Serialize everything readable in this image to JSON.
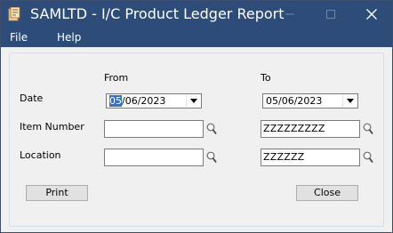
{
  "window": {
    "title": "SAMLTD - I/C Product Ledger Report",
    "min_label": "—",
    "max_label": "□",
    "close_label": "✕"
  },
  "menu": {
    "file": "File",
    "help": "Help"
  },
  "form": {
    "from_header": "From",
    "to_header": "To",
    "date_label": "Date",
    "item_label": "Item Number",
    "location_label": "Location",
    "date_from_selected": "05",
    "date_from_rest": "/06/2023",
    "date_to": "05/06/2023",
    "item_from": "",
    "item_to": "ZZZZZZZZZ",
    "location_from": "",
    "location_to": "ZZZZZZ"
  },
  "buttons": {
    "print": "Print",
    "close": "Close"
  },
  "icons": {
    "app": "ledger-report-icon",
    "finder": "magnifier-icon",
    "dropdown": "chevron-down-icon"
  },
  "colors": {
    "titlebar": "#2d4c7a",
    "selection": "#3370c6",
    "client": "#f0f0f0"
  }
}
